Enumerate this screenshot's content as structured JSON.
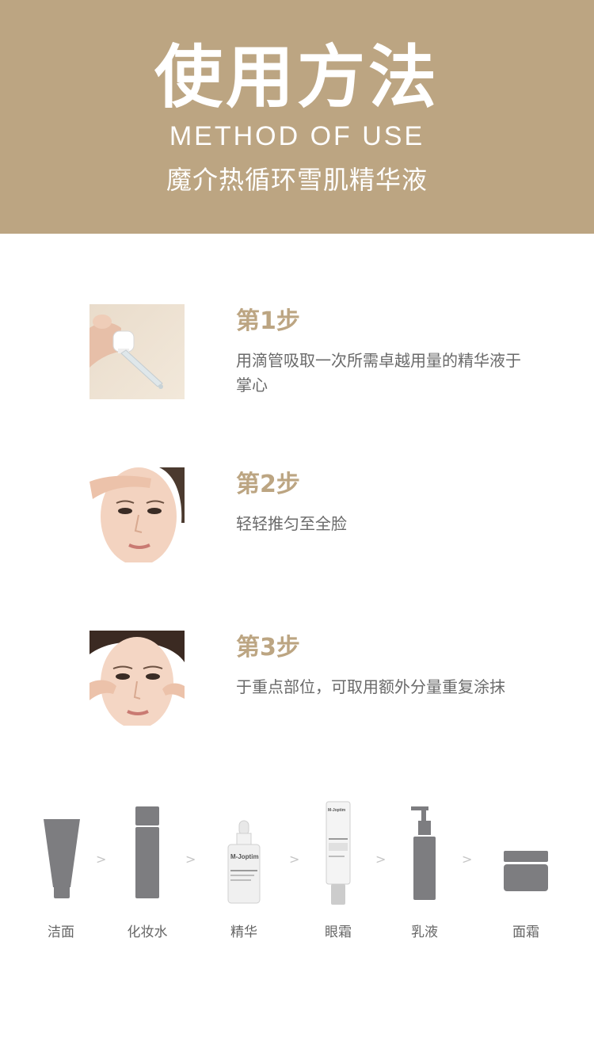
{
  "header": {
    "title": "使用方法",
    "subtitle": "METHOD OF USE",
    "product": "魔介热循环雪肌精华液"
  },
  "colors": {
    "accent": "#bca582",
    "text": "#6a6a6a",
    "icon": "#7d7d80"
  },
  "steps": [
    {
      "label": "第1步",
      "text": "用滴管吸取一次所需卓越用量的精华液于掌心",
      "image": "dropper-in-hand-photo"
    },
    {
      "label": "第2步",
      "text": "轻轻推匀至全脸",
      "image": "woman-applying-forehead-photo"
    },
    {
      "label": "第3步",
      "text": "于重点部位，可取用额外分量重复涂抹",
      "image": "woman-applying-undereye-photo"
    }
  ],
  "routine": {
    "separator": ">",
    "items": [
      {
        "label": "洁面",
        "icon": "cleanser-tube-icon"
      },
      {
        "label": "化妆水",
        "icon": "toner-bottle-icon"
      },
      {
        "label": "精华",
        "icon": "serum-dropper-bottle-icon",
        "brand": "M-Joptim"
      },
      {
        "label": "眼霜",
        "icon": "eye-cream-tube-icon",
        "brand": "M-Joptim"
      },
      {
        "label": "乳液",
        "icon": "lotion-pump-bottle-icon"
      },
      {
        "label": "面霜",
        "icon": "cream-jar-icon"
      }
    ]
  }
}
